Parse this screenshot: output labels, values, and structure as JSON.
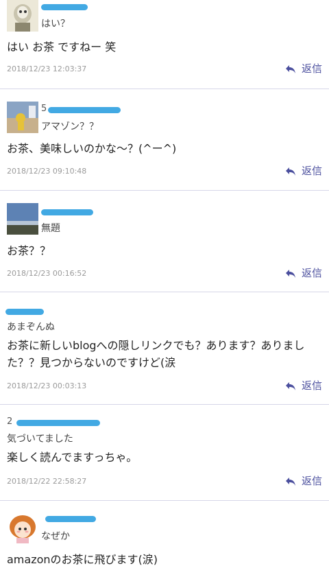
{
  "reply_label": "返信",
  "comments": [
    {
      "author": "",
      "title": "はい？",
      "body": "はい お茶 ですねー 笑",
      "time": "2018/12/23 12:03:37"
    },
    {
      "author": "5",
      "title": "アマゾン？？",
      "body": "お茶、美味しいのかな～？(^ー^)",
      "time": "2018/12/23 09:10:48"
    },
    {
      "author": "",
      "title": "無題",
      "body": "お茶？？",
      "time": "2018/12/23 00:16:52"
    },
    {
      "author": "",
      "title": "あまぞんぬ",
      "body": "お茶に新しいblogへの隠しリンクでも？あります？ありました？？見つからないのですけど(涙",
      "time": "2018/12/23 00:03:13"
    },
    {
      "author": "2",
      "title": "気づいてました",
      "body": "楽しく読んでますっちゃ。",
      "time": "2018/12/22 22:58:27"
    },
    {
      "author": "",
      "title": "なぜか",
      "body": "amazonのお茶に飛びます(涙)",
      "time": ""
    }
  ],
  "colors": {
    "accent": "#4b4f9e",
    "divider": "#d6d6e8",
    "redaction": "#2ea0e0"
  }
}
